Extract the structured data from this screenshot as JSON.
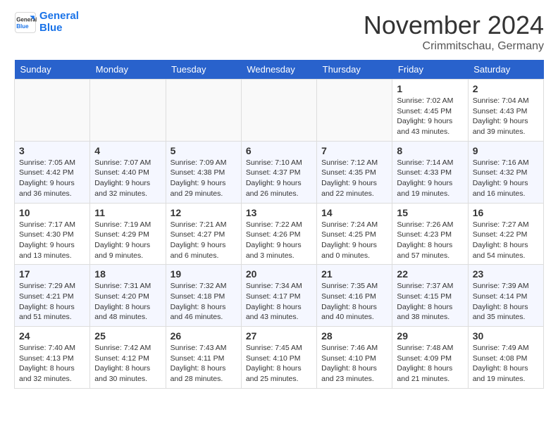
{
  "header": {
    "logo_line1": "General",
    "logo_line2": "Blue",
    "month": "November 2024",
    "location": "Crimmitschau, Germany"
  },
  "days_of_week": [
    "Sunday",
    "Monday",
    "Tuesday",
    "Wednesday",
    "Thursday",
    "Friday",
    "Saturday"
  ],
  "weeks": [
    [
      {
        "day": "",
        "info": ""
      },
      {
        "day": "",
        "info": ""
      },
      {
        "day": "",
        "info": ""
      },
      {
        "day": "",
        "info": ""
      },
      {
        "day": "",
        "info": ""
      },
      {
        "day": "1",
        "info": "Sunrise: 7:02 AM\nSunset: 4:45 PM\nDaylight: 9 hours and 43 minutes."
      },
      {
        "day": "2",
        "info": "Sunrise: 7:04 AM\nSunset: 4:43 PM\nDaylight: 9 hours and 39 minutes."
      }
    ],
    [
      {
        "day": "3",
        "info": "Sunrise: 7:05 AM\nSunset: 4:42 PM\nDaylight: 9 hours and 36 minutes."
      },
      {
        "day": "4",
        "info": "Sunrise: 7:07 AM\nSunset: 4:40 PM\nDaylight: 9 hours and 32 minutes."
      },
      {
        "day": "5",
        "info": "Sunrise: 7:09 AM\nSunset: 4:38 PM\nDaylight: 9 hours and 29 minutes."
      },
      {
        "day": "6",
        "info": "Sunrise: 7:10 AM\nSunset: 4:37 PM\nDaylight: 9 hours and 26 minutes."
      },
      {
        "day": "7",
        "info": "Sunrise: 7:12 AM\nSunset: 4:35 PM\nDaylight: 9 hours and 22 minutes."
      },
      {
        "day": "8",
        "info": "Sunrise: 7:14 AM\nSunset: 4:33 PM\nDaylight: 9 hours and 19 minutes."
      },
      {
        "day": "9",
        "info": "Sunrise: 7:16 AM\nSunset: 4:32 PM\nDaylight: 9 hours and 16 minutes."
      }
    ],
    [
      {
        "day": "10",
        "info": "Sunrise: 7:17 AM\nSunset: 4:30 PM\nDaylight: 9 hours and 13 minutes."
      },
      {
        "day": "11",
        "info": "Sunrise: 7:19 AM\nSunset: 4:29 PM\nDaylight: 9 hours and 9 minutes."
      },
      {
        "day": "12",
        "info": "Sunrise: 7:21 AM\nSunset: 4:27 PM\nDaylight: 9 hours and 6 minutes."
      },
      {
        "day": "13",
        "info": "Sunrise: 7:22 AM\nSunset: 4:26 PM\nDaylight: 9 hours and 3 minutes."
      },
      {
        "day": "14",
        "info": "Sunrise: 7:24 AM\nSunset: 4:25 PM\nDaylight: 9 hours and 0 minutes."
      },
      {
        "day": "15",
        "info": "Sunrise: 7:26 AM\nSunset: 4:23 PM\nDaylight: 8 hours and 57 minutes."
      },
      {
        "day": "16",
        "info": "Sunrise: 7:27 AM\nSunset: 4:22 PM\nDaylight: 8 hours and 54 minutes."
      }
    ],
    [
      {
        "day": "17",
        "info": "Sunrise: 7:29 AM\nSunset: 4:21 PM\nDaylight: 8 hours and 51 minutes."
      },
      {
        "day": "18",
        "info": "Sunrise: 7:31 AM\nSunset: 4:20 PM\nDaylight: 8 hours and 48 minutes."
      },
      {
        "day": "19",
        "info": "Sunrise: 7:32 AM\nSunset: 4:18 PM\nDaylight: 8 hours and 46 minutes."
      },
      {
        "day": "20",
        "info": "Sunrise: 7:34 AM\nSunset: 4:17 PM\nDaylight: 8 hours and 43 minutes."
      },
      {
        "day": "21",
        "info": "Sunrise: 7:35 AM\nSunset: 4:16 PM\nDaylight: 8 hours and 40 minutes."
      },
      {
        "day": "22",
        "info": "Sunrise: 7:37 AM\nSunset: 4:15 PM\nDaylight: 8 hours and 38 minutes."
      },
      {
        "day": "23",
        "info": "Sunrise: 7:39 AM\nSunset: 4:14 PM\nDaylight: 8 hours and 35 minutes."
      }
    ],
    [
      {
        "day": "24",
        "info": "Sunrise: 7:40 AM\nSunset: 4:13 PM\nDaylight: 8 hours and 32 minutes."
      },
      {
        "day": "25",
        "info": "Sunrise: 7:42 AM\nSunset: 4:12 PM\nDaylight: 8 hours and 30 minutes."
      },
      {
        "day": "26",
        "info": "Sunrise: 7:43 AM\nSunset: 4:11 PM\nDaylight: 8 hours and 28 minutes."
      },
      {
        "day": "27",
        "info": "Sunrise: 7:45 AM\nSunset: 4:10 PM\nDaylight: 8 hours and 25 minutes."
      },
      {
        "day": "28",
        "info": "Sunrise: 7:46 AM\nSunset: 4:10 PM\nDaylight: 8 hours and 23 minutes."
      },
      {
        "day": "29",
        "info": "Sunrise: 7:48 AM\nSunset: 4:09 PM\nDaylight: 8 hours and 21 minutes."
      },
      {
        "day": "30",
        "info": "Sunrise: 7:49 AM\nSunset: 4:08 PM\nDaylight: 8 hours and 19 minutes."
      }
    ]
  ]
}
